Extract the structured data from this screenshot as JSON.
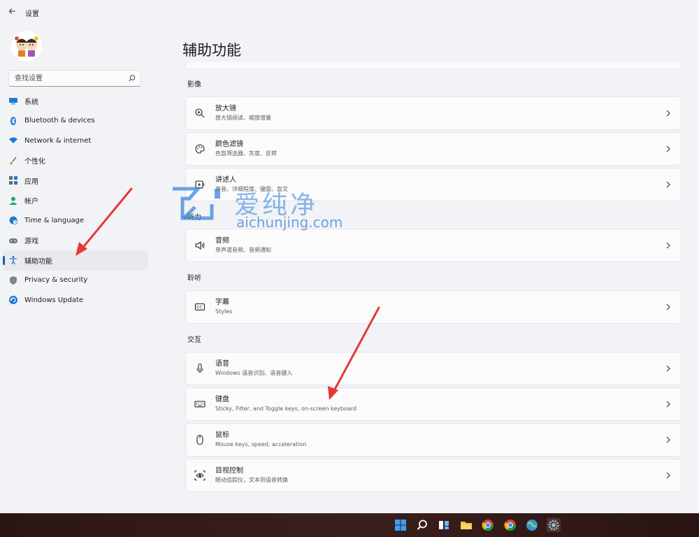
{
  "window": {
    "title": "设置",
    "back_icon": "back-arrow-icon"
  },
  "sidebar": {
    "search_placeholder": "查找设置",
    "items": [
      {
        "label": "系统",
        "icon": "monitor-icon",
        "color": "#1e7ad1"
      },
      {
        "label": "Bluetooth & devices",
        "icon": "bluetooth-icon",
        "color": "#1e7ad1"
      },
      {
        "label": "Network & internet",
        "icon": "wifi-icon",
        "color": "#1e7ad1"
      },
      {
        "label": "个性化",
        "icon": "brush-icon",
        "color": "#d08a3a"
      },
      {
        "label": "应用",
        "icon": "apps-icon",
        "color": "#5a6b82"
      },
      {
        "label": "帐户",
        "icon": "account-icon",
        "color": "#2aa36b"
      },
      {
        "label": "Time & language",
        "icon": "globe-clock-icon",
        "color": "#1e7ad1"
      },
      {
        "label": "游戏",
        "icon": "gamepad-icon",
        "color": "#6d7787"
      },
      {
        "label": "辅助功能",
        "icon": "accessibility-icon",
        "color": "#1e7ad1"
      },
      {
        "label": "Privacy & security",
        "icon": "shield-icon",
        "color": "#7b8290"
      },
      {
        "label": "Windows Update",
        "icon": "update-icon",
        "color": "#1e7ad1"
      }
    ],
    "active_index": 8
  },
  "main": {
    "title": "辅助功能",
    "sections": [
      {
        "header": "影像",
        "cards": [
          {
            "title": "放大镜",
            "subtitle": "放大镜阅读、缩放增量",
            "icon": "magnifier-icon"
          },
          {
            "title": "颜色滤镜",
            "subtitle": "色盲筛选器、灰度、反转",
            "icon": "palette-icon"
          },
          {
            "title": "讲述人",
            "subtitle": "声音、详细程度、键盘、盲文",
            "icon": "narrator-icon"
          }
        ]
      },
      {
        "header": "听力",
        "cards": [
          {
            "title": "音频",
            "subtitle": "单声道音频、音频通知",
            "icon": "speaker-icon"
          }
        ]
      },
      {
        "header": "聆听",
        "cards": [
          {
            "title": "字幕",
            "subtitle": "Styles",
            "icon": "captions-icon"
          }
        ]
      },
      {
        "header": "交互",
        "cards": [
          {
            "title": "语音",
            "subtitle": "Windows 语音识别、语音键入",
            "icon": "microphone-icon"
          },
          {
            "title": "键盘",
            "subtitle": "Sticky, Filter, and Toggle keys, on-screen keyboard",
            "icon": "keyboard-icon"
          },
          {
            "title": "鼠标",
            "subtitle": "Mouse keys, speed, acceleration",
            "icon": "mouse-icon"
          },
          {
            "title": "目视控制",
            "subtitle": "眼动追踪仪，文本到语音转换",
            "icon": "eye-control-icon"
          }
        ]
      }
    ]
  },
  "watermark": {
    "cn": "爱纯净",
    "en": "aichunjing.com",
    "color": "#2e7fd6"
  },
  "annotations": {
    "arrow_color": "#e53935"
  },
  "taskbar": {
    "icons": [
      "start-icon",
      "search-icon",
      "task-view-icon",
      "file-explorer-icon",
      "chrome-icon",
      "chrome-icon",
      "browser-icon",
      "settings-icon"
    ]
  }
}
